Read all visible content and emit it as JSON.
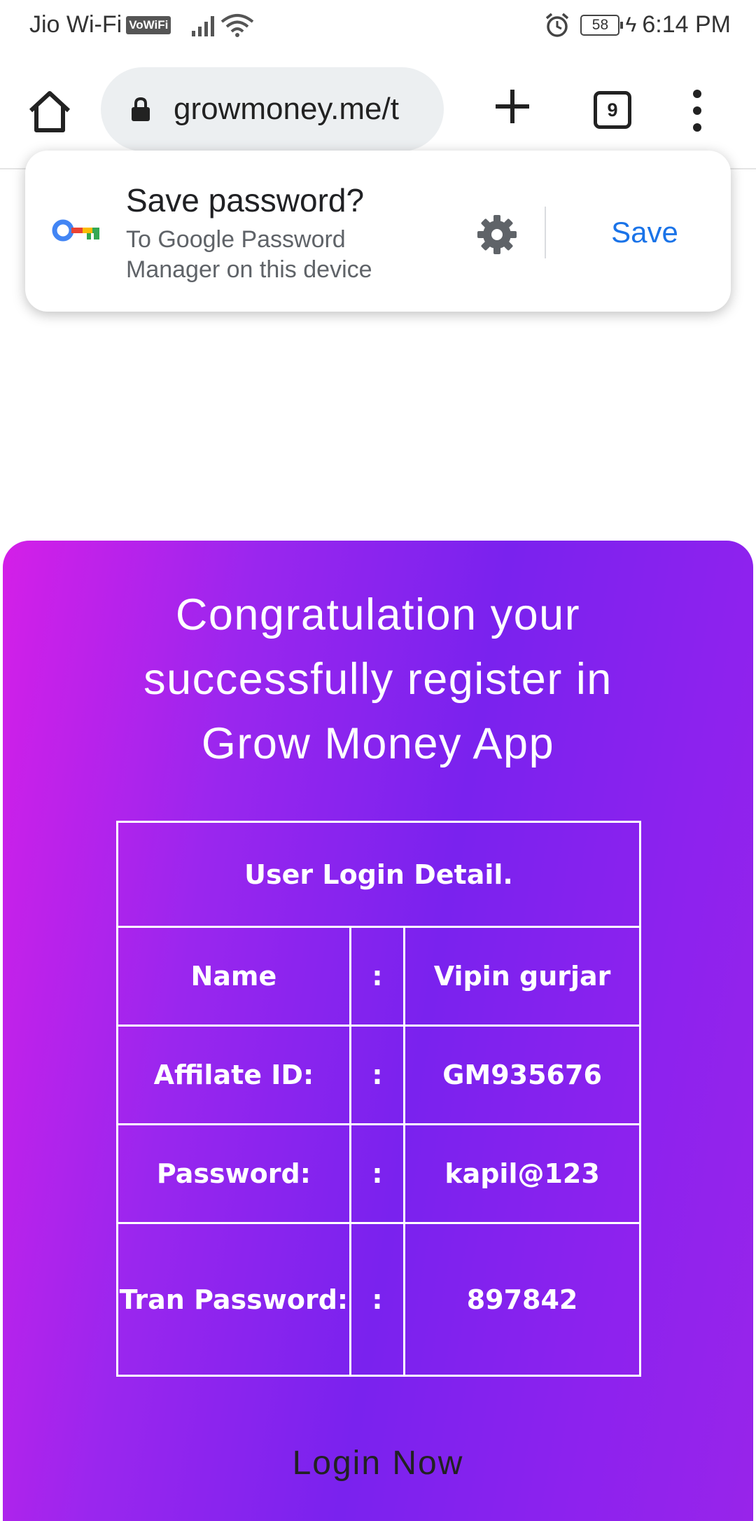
{
  "status_bar": {
    "carrier": "Jio Wi-Fi",
    "vowifi": "VoWiFi",
    "battery": "58",
    "time": "6:14 PM",
    "icons": [
      "signal-icon",
      "wifi-icon",
      "alarm-icon",
      "charging-icon"
    ]
  },
  "browser": {
    "url": "growmoney.me/t",
    "tab_count": "9",
    "icons": [
      "home-icon",
      "lock-icon",
      "plus-icon",
      "more-vert-icon"
    ]
  },
  "save_password": {
    "title": "Save password?",
    "subtitle": "To Google Password Manager on this device",
    "save_label": "Save",
    "icons": [
      "key-icon",
      "gear-icon"
    ]
  },
  "registration": {
    "title": "Congratulation your successfully register in Grow Money App",
    "table_header": "User Login Detail.",
    "separator": ":",
    "rows": [
      {
        "label": "Name",
        "value": "Vipin gurjar"
      },
      {
        "label": "Affilate ID:",
        "value": "GM935676"
      },
      {
        "label": "Password:",
        "value": "kapil@123"
      },
      {
        "label": "Tran Password:",
        "value": "897842"
      }
    ],
    "login_label": "Login Now"
  },
  "colors": {
    "gradient_start": "#d41fe8",
    "gradient_mid": "#7a22ee",
    "link_blue": "#1a73e8"
  }
}
